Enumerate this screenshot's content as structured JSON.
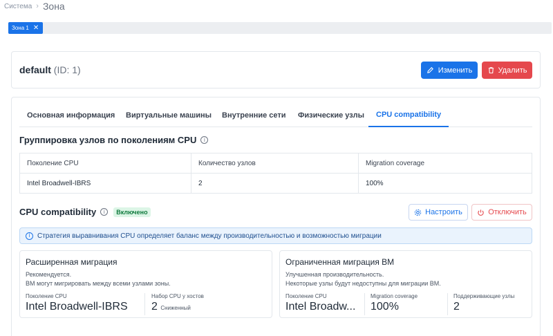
{
  "breadcrumb": {
    "root": "Система",
    "current": "Зона"
  },
  "zone_tab": {
    "label": "Зона 1"
  },
  "entity": {
    "name": "default",
    "id": "(ID: 1)"
  },
  "actions": {
    "edit": "Изменить",
    "delete": "Удалить"
  },
  "tabs": [
    "Основная информация",
    "Виртуальные машины",
    "Внутренние сети",
    "Физические узлы",
    "CPU compatibility"
  ],
  "generations": {
    "title": "Группировка узлов по поколениям CPU",
    "columns": [
      "Поколение CPU",
      "Количество узлов",
      "Migration coverage"
    ],
    "rows": [
      [
        "Intel Broadwell-IBRS",
        "2",
        "100%"
      ]
    ]
  },
  "compat": {
    "title": "CPU compatibility",
    "badge": "Включено",
    "configure": "Настроить",
    "disable": "Отключить",
    "alert": "Стратегия выравнивания CPU определяет баланс между производительностью и возможностью миграции"
  },
  "extended": {
    "title": "Расширенная миграция",
    "desc1": "Рекомендуется.",
    "desc2": "ВМ могут мигрировать между всеми узлами зоны.",
    "gen_label": "Поколение CPU",
    "gen_value": "Intel Broadwell-IBRS",
    "set_label": "Набор CPU у хостов",
    "set_value": "2",
    "set_sub": "Сниженный"
  },
  "limited": {
    "title": "Ограниченная миграция ВМ",
    "desc1": "Улучшенная производительность.",
    "desc2": "Некоторые узлы будут недоступны для миграции ВМ.",
    "gen_label": "Поколение CPU",
    "gen_value": "Intel Broadw...",
    "cov_label": "Migration coverage",
    "cov_value": "100%",
    "sup_label": "Поддерживающие узлы",
    "sup_value": "2"
  },
  "colors": {
    "accent": "#1a73e8",
    "danger": "#e5484d",
    "success": "#0f7a3d"
  }
}
